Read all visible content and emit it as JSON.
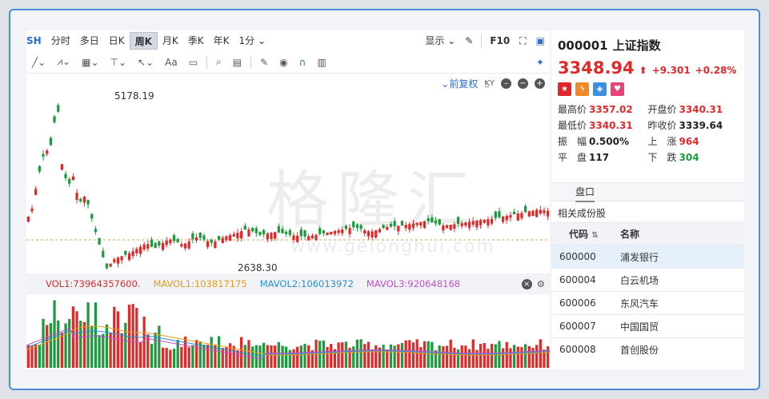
{
  "toolbar": {
    "symbol": "SH",
    "periods": [
      "分时",
      "多日",
      "日K",
      "周K",
      "月K",
      "季K",
      "年K",
      "1分 ⌄"
    ],
    "active_period": "周K",
    "display_label": "显示 ⌄",
    "f10_label": "F10"
  },
  "tools": {
    "text_tool": "Aa",
    "fuquan_label": "⌄前复权"
  },
  "watermark": {
    "brand": "格隆汇",
    "url": "www.gelonghui.com"
  },
  "price_chart": {
    "high_label": "5178.19",
    "low_label": "2638.30",
    "colors": {
      "up": "#e02a2a",
      "down": "#1c9a3e",
      "ref_line": "#e6a23c"
    }
  },
  "volume_legend": {
    "vol1": "VOL1:73964357600.",
    "mavol1": "MAVOL1:103817175",
    "mavol2": "MAVOL2:106013972",
    "mavol3": "MAVOL3:920648168",
    "colors": {
      "vol1": "#e02a2a",
      "mavol1": "#e69a1b",
      "mavol2": "#2a8fd6",
      "mavol3": "#c24fc9"
    }
  },
  "quote": {
    "code": "000001",
    "name": "上证指数",
    "price": "3348.94",
    "arrow": "⬆",
    "change": "+9.301",
    "change_pct": "+0.28%",
    "stats": [
      {
        "label": "最高价",
        "value": "3357.02",
        "color": "red"
      },
      {
        "label": "开盘价",
        "value": "3340.31",
        "color": "red"
      },
      {
        "label": "最低价",
        "value": "3340.31",
        "color": "red"
      },
      {
        "label": "昨收价",
        "value": "3339.64",
        "color": "blk"
      },
      {
        "label": "振　幅",
        "value": "0.500%",
        "color": "blk"
      },
      {
        "label": "上　涨",
        "value": "964",
        "color": "red"
      },
      {
        "label": "平　盘",
        "value": "117",
        "color": "blk"
      },
      {
        "label": "下　跌",
        "value": "304",
        "color": "green"
      }
    ]
  },
  "panel": {
    "tab_label": "盘口",
    "related_title": "相关成份股",
    "table_headers": {
      "code": "代码",
      "name": "名称",
      "sort_icon": "⇅"
    },
    "rows": [
      {
        "code": "600000",
        "name": "浦发银行"
      },
      {
        "code": "600004",
        "name": "白云机场"
      },
      {
        "code": "600006",
        "name": "东风汽车"
      },
      {
        "code": "600007",
        "name": "中国国贸"
      },
      {
        "code": "600008",
        "name": "首创股份"
      }
    ]
  }
}
